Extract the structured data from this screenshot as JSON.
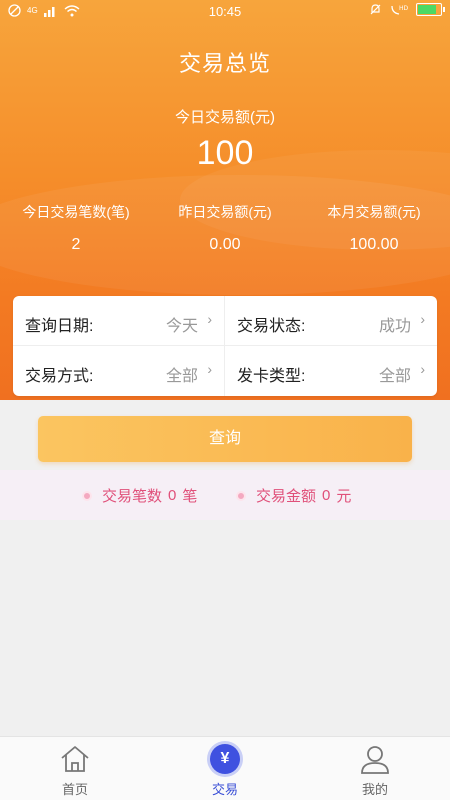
{
  "status_bar": {
    "time": "10:45",
    "signal_text": "4G"
  },
  "header": {
    "title": "交易总览",
    "today_amount_label": "今日交易额(元)",
    "today_amount_value": "100",
    "stats": [
      {
        "label": "今日交易笔数(笔)",
        "value": "2"
      },
      {
        "label": "昨日交易额(元)",
        "value": "0.00"
      },
      {
        "label": "本月交易额(元)",
        "value": "100.00"
      }
    ]
  },
  "filters": {
    "query_date": {
      "label": "查询日期:",
      "value": "今天"
    },
    "trade_status": {
      "label": "交易状态:",
      "value": "成功"
    },
    "trade_method": {
      "label": "交易方式:",
      "value": "全部"
    },
    "card_type": {
      "label": "发卡类型:",
      "value": "全部"
    },
    "chevron": "›"
  },
  "query_button": "查询",
  "summary": {
    "count_label": "交易笔数",
    "count_value": "0",
    "count_unit": "笔",
    "amount_label": "交易金额",
    "amount_value": "0",
    "amount_unit": "元"
  },
  "tabbar": {
    "tabs": [
      {
        "label": "首页",
        "icon": "home-icon"
      },
      {
        "label": "交易",
        "icon": "yen-icon",
        "active": true
      },
      {
        "label": "我的",
        "icon": "user-icon"
      }
    ],
    "yen_glyph": "¥"
  },
  "colors": {
    "header_orange": "#f58d2a",
    "button_orange": "#f9b24a",
    "summary_pink": "#e0507a",
    "active_tab_blue": "#3f51e0"
  }
}
